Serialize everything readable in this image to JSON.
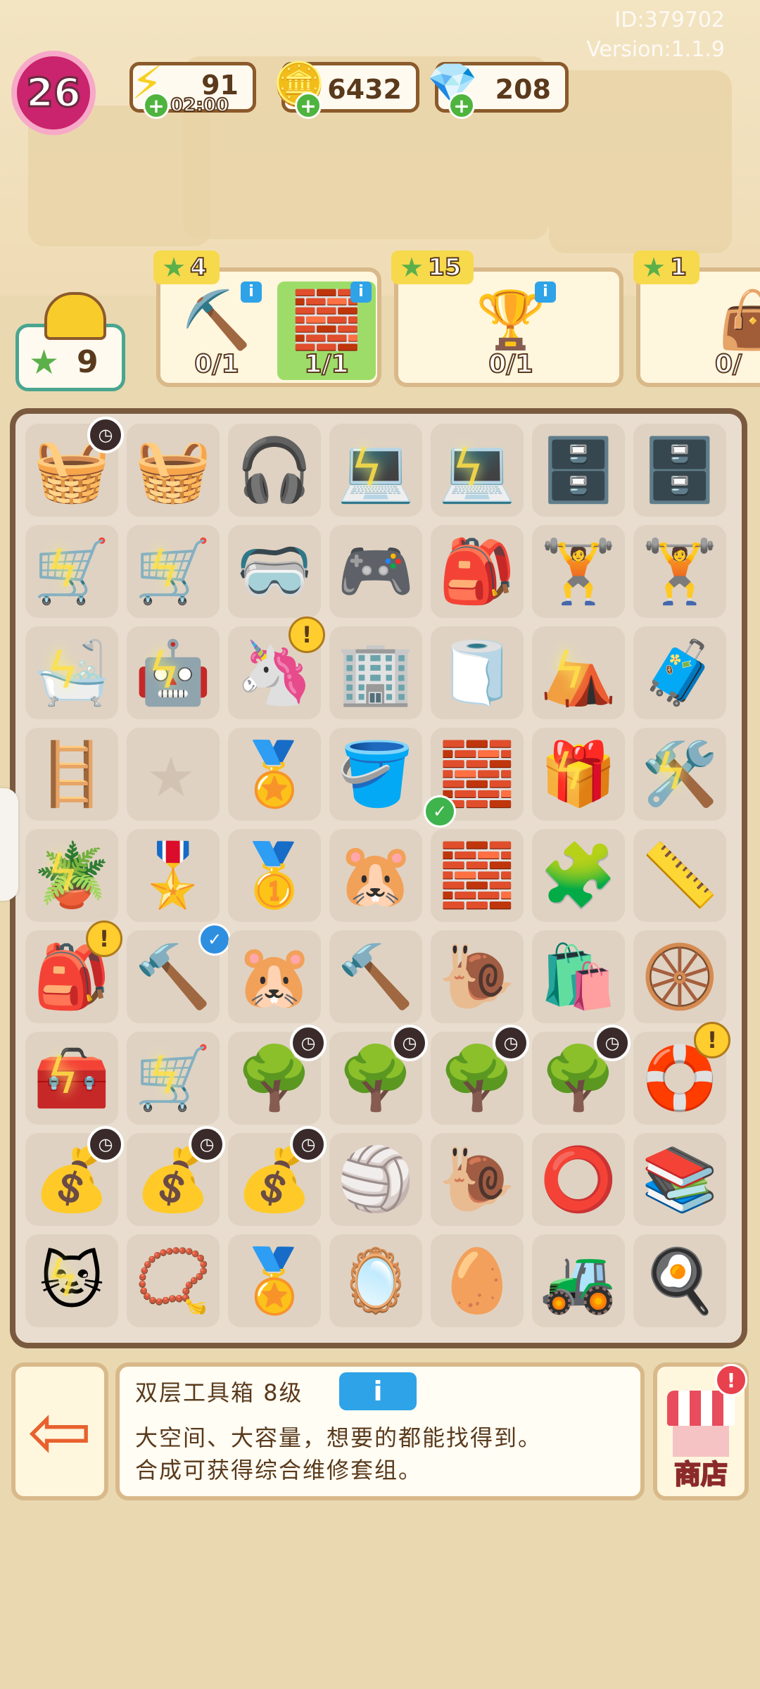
{
  "header": {
    "id_text": "ID:379702",
    "version_text": "Version:1.1.9",
    "level": "26",
    "energy": {
      "value": "91",
      "timer": "02:00",
      "icon": "lightning-icon"
    },
    "coins": {
      "value": "6432",
      "icon": "coin-icon"
    },
    "gems": {
      "value": "208",
      "icon": "gem-icon"
    }
  },
  "stars_total": "9",
  "tasks": [
    {
      "reward": "4",
      "items": [
        {
          "icon": "pickaxe-icon",
          "count": "0/1"
        },
        {
          "icon": "brick-pallet-icon",
          "count": "1/1",
          "done": true
        }
      ]
    },
    {
      "reward": "15",
      "items": [
        {
          "icon": "trophy-icon",
          "count": "0/1"
        }
      ]
    },
    {
      "reward": "1",
      "items": [
        {
          "icon": "bag-icon",
          "count": "0/"
        }
      ]
    }
  ],
  "board": {
    "rows": [
      [
        {
          "e": "🧺",
          "clock": true
        },
        {
          "e": "🧺"
        },
        {
          "e": "🎧"
        },
        {
          "e": "💻",
          "bolt": true
        },
        {
          "e": "💻",
          "bolt": true
        },
        {
          "e": "🗄️"
        },
        {
          "e": "🗄️"
        }
      ],
      [
        {
          "e": "🛒",
          "bolt": true
        },
        {
          "e": "🛒",
          "bolt": true
        },
        {
          "e": "🥽"
        },
        {
          "e": "🎮"
        },
        {
          "e": "🎒"
        },
        {
          "e": "🏋️"
        },
        {
          "e": "🏋️"
        }
      ],
      [
        {
          "e": "🛁",
          "bolt": true
        },
        {
          "e": "🤖",
          "bolt": true
        },
        {
          "e": "🦄",
          "alert": true
        },
        {
          "e": "🏢"
        },
        {
          "e": "🧻"
        },
        {
          "e": "⛺",
          "bolt": true
        },
        {
          "e": "🧳"
        }
      ],
      [
        {
          "e": "🪜"
        },
        {
          "empty": true
        },
        {
          "e": "🏅"
        },
        {
          "e": "🪣"
        },
        {
          "e": "🧱",
          "check": true
        },
        {
          "e": "🎁",
          "bolt": true
        },
        {
          "e": "🛠️",
          "bolt": true
        }
      ],
      [
        {
          "e": "🪴",
          "bolt": true
        },
        {
          "e": "🎖️"
        },
        {
          "e": "🥇"
        },
        {
          "e": "🐹"
        },
        {
          "e": "🧱"
        },
        {
          "e": "🧩"
        },
        {
          "e": "📏"
        }
      ],
      [
        {
          "e": "🎒",
          "alert": true
        },
        {
          "e": "🔨",
          "check2": true
        },
        {
          "e": "🐹"
        },
        {
          "e": "🔨"
        },
        {
          "e": "🐌"
        },
        {
          "e": "🛍️"
        },
        {
          "e": "🛞"
        }
      ],
      [
        {
          "e": "🧰",
          "bolt": true
        },
        {
          "e": "🛒",
          "bolt": true
        },
        {
          "e": "🌳",
          "clock": true
        },
        {
          "e": "🌳",
          "clock": true
        },
        {
          "e": "🌳",
          "clock": true
        },
        {
          "e": "🌳",
          "clock": true
        },
        {
          "e": "🛟",
          "alert": true
        }
      ],
      [
        {
          "e": "💰",
          "clock": true
        },
        {
          "e": "💰",
          "clock": true
        },
        {
          "e": "💰",
          "clock": true
        },
        {
          "e": "🏐"
        },
        {
          "e": "🐌"
        },
        {
          "e": "⭕"
        },
        {
          "e": "📚"
        }
      ],
      [
        {
          "e": "🐱",
          "bolt": true
        },
        {
          "e": "📿"
        },
        {
          "e": "🏅"
        },
        {
          "e": "🪞"
        },
        {
          "e": "🥚"
        },
        {
          "e": "🚜"
        },
        {
          "e": "🍳"
        }
      ]
    ]
  },
  "footer": {
    "item_name": "双层工具箱 8级",
    "info_label": "i",
    "desc_line1": "大空间、大容量，想要的都能找得到。",
    "desc_line2": "合成可获得综合维修套组。",
    "shop_label": "商店",
    "exit_icon": "exit-door-icon"
  },
  "colors": {
    "frame": "#7a5a3f",
    "board": "#e8ddcf",
    "accent_green": "#5bb04a",
    "info_blue": "#2ea3e8"
  }
}
